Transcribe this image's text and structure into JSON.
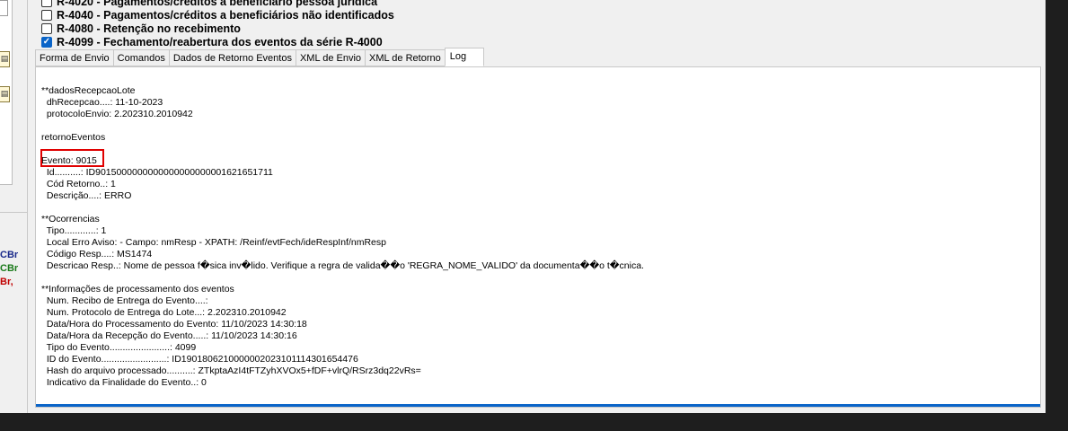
{
  "checklist": [
    {
      "label": "R-4020 - Pagamentos/créditos a beneficiário pessoa jurídica",
      "checked": false
    },
    {
      "label": "R-4040 - Pagamentos/créditos a beneficiários não identificados",
      "checked": false
    },
    {
      "label": "R-4080 - Retenção no recebimento",
      "checked": false
    },
    {
      "label": "R-4099 - Fechamento/reabertura dos eventos da série R-4000",
      "checked": true
    }
  ],
  "tabs": [
    "Forma de Envio",
    "Comandos",
    "Dados de Retorno Eventos",
    "XML de Envio",
    "XML de Retorno",
    "Log"
  ],
  "active_tab": "Log",
  "left_labels": [
    {
      "text": "CBr",
      "color": "#1a2a8a"
    },
    {
      "text": "CBr",
      "color": "#1a7a1a"
    },
    {
      "text": "Br,",
      "color": "#c00000"
    }
  ],
  "log_lines": [
    "**dadosRecepcaoLote",
    "  dhRecepcao....: 11-10-2023",
    "  protocoloEnvio: 2.202310.2010942",
    "",
    "retornoEventos",
    "",
    "Evento: 9015",
    "  Id..........: ID9015000000000000000000001621651711",
    "  Cód Retorno..: 1",
    "  Descrição....: ERRO",
    "",
    "**Ocorrencias",
    "  Tipo............: 1",
    "  Local Erro Aviso: - Campo: nmResp - XPATH: /Reinf/evtFech/ideRespInf/nmResp",
    "  Código Resp....: MS1474",
    "  Descricao Resp..: Nome de pessoa f�sica inv�lido. Verifique a regra de valida��o 'REGRA_NOME_VALIDO' da documenta��o t�cnica.",
    "",
    "**Informações de processamento dos eventos",
    "  Num. Recibo de Entrega do Evento....:",
    "  Num. Protocolo de Entrega do Lote...: 2.202310.2010942",
    "  Data/Hora do Processamento do Evento: 11/10/2023 14:30:18",
    "  Data/Hora da Recepção do Evento.....: 11/10/2023 14:30:16",
    "  Tipo do Evento.......................: 4099",
    "  ID do Evento.........................: ID1901806210000002023101114301654476",
    "  Hash do arquivo processado..........: ZTkptaAzI4tFTZyhXVOx5+fDF+vlrQ/RSrz3dq22vRs=",
    "  Indicativo da Finalidade do Evento..: 0"
  ]
}
